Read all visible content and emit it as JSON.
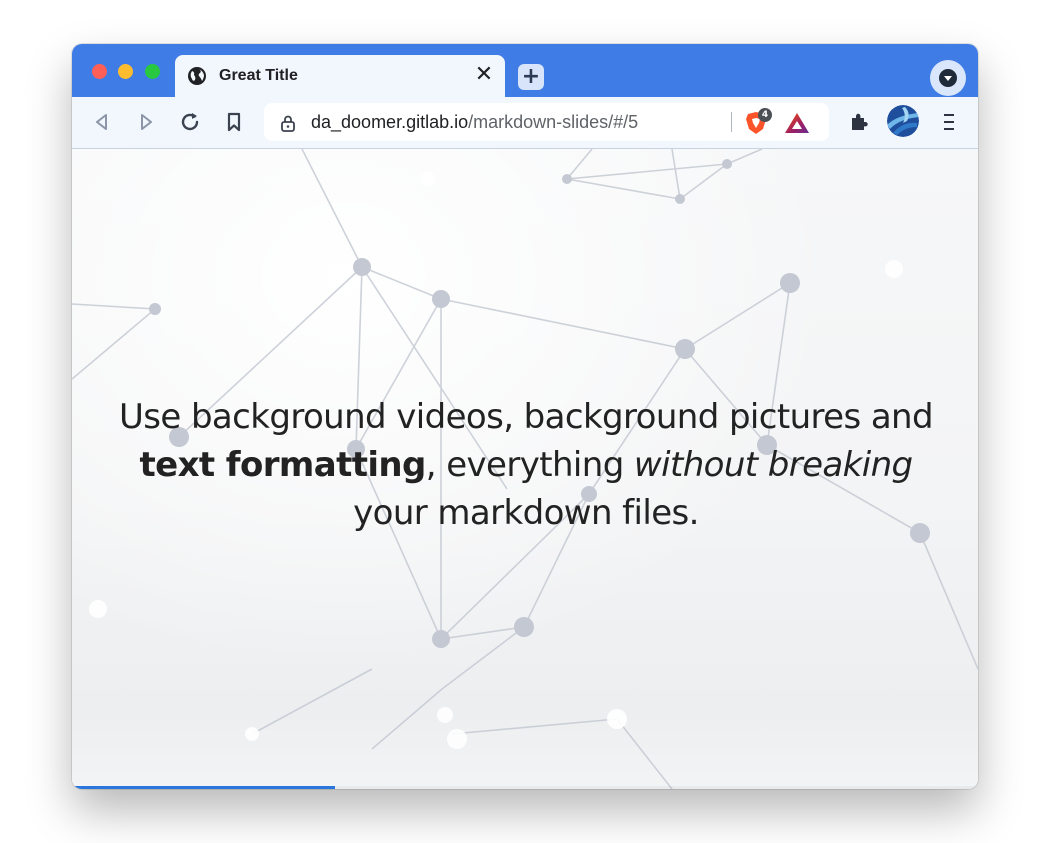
{
  "browser": {
    "tab": {
      "title": "Great Title",
      "close_label": "✕"
    },
    "new_tab_label": "+",
    "address": {
      "host": "da_doomer.gitlab.io",
      "path": "/markdown-slides/#/5"
    },
    "brave_shields_count": "4",
    "accent_color": "#3f7ce6"
  },
  "slide": {
    "part1": "Use background videos, background pictures and ",
    "bold1": "text formatting",
    "part2": ", everything ",
    "italic1": "without breaking",
    "part3": " your markdown files."
  },
  "progress": {
    "fraction": 0.29,
    "color": "#2a76dd"
  }
}
